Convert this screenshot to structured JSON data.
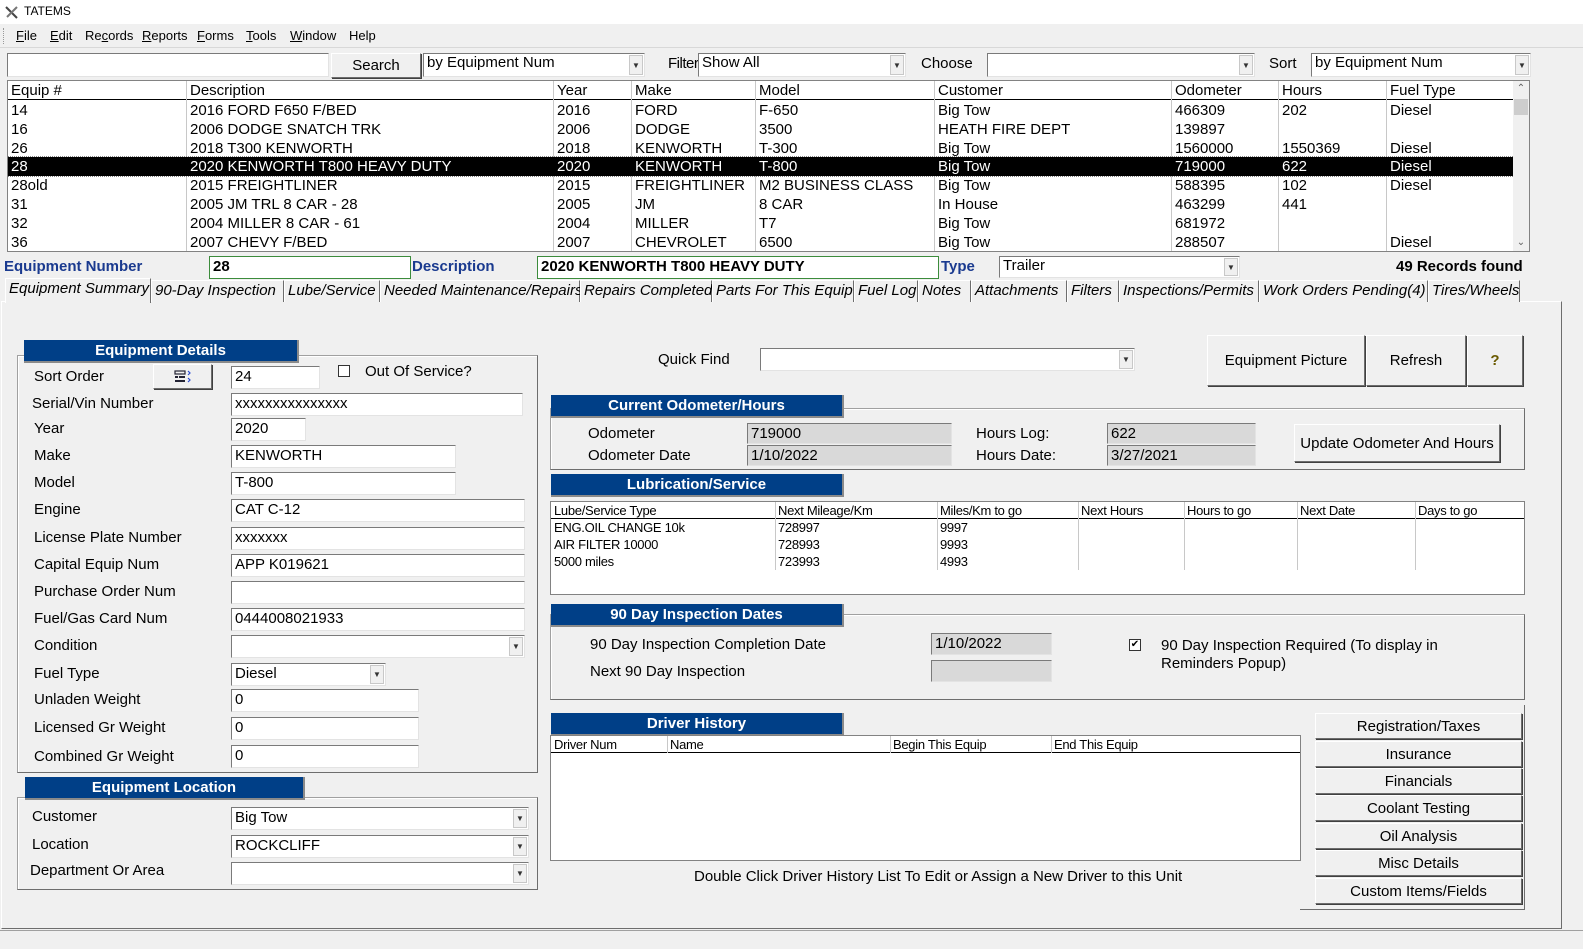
{
  "window": {
    "title": "TATEMS"
  },
  "menu": [
    {
      "label": "File",
      "u": "F",
      "rest": "ile"
    },
    {
      "label": "Edit",
      "u": "E",
      "rest": "dit"
    },
    {
      "label": "Records",
      "pre": "Re",
      "u": "c",
      "rest": "ords"
    },
    {
      "label": "Reports",
      "u": "R",
      "rest": "eports"
    },
    {
      "label": "Forms",
      "u": "F",
      "rest": "orms"
    },
    {
      "label": "Tools",
      "u": "T",
      "rest": "ools"
    },
    {
      "label": "Window",
      "u": "W",
      "rest": "indow"
    },
    {
      "label": "Help",
      "u": "",
      "rest": "Help"
    }
  ],
  "toolbar": {
    "search_value": "",
    "search_button": "Search",
    "search_by": "by Equipment Num",
    "filter_label": "Filter",
    "filter_value": "Show All",
    "choose_label": "Choose",
    "choose_value": "",
    "sort_label": "Sort",
    "sort_value": "by Equipment Num"
  },
  "equipment_list": {
    "columns": [
      "Equip #",
      "Description",
      "Year",
      "Make",
      "Model",
      "Customer",
      "Odometer",
      "Hours",
      "Fuel Type"
    ],
    "rows": [
      [
        "14",
        "2016 FORD F650 F/BED",
        "2016",
        "FORD",
        "F-650",
        "Big Tow",
        "466309",
        "202",
        "Diesel"
      ],
      [
        "16",
        "2006 DODGE  SNATCH TRK",
        "2006",
        "DODGE",
        "3500",
        "HEATH FIRE DEPT",
        "139897",
        "",
        ""
      ],
      [
        "26",
        "2018 T300 KENWORTH",
        "2018",
        "KENWORTH",
        "T-300",
        "Big Tow",
        "1560000",
        "1550369",
        "Diesel"
      ],
      [
        "28",
        "2020 KENWORTH T800 HEAVY DUTY",
        "2020",
        "KENWORTH",
        "T-800",
        "Big Tow",
        "719000",
        "622",
        "Diesel"
      ],
      [
        "28old",
        "2015 FREIGHTLINER",
        "2015",
        "FREIGHTLINER",
        "M2 BUSINESS CLASS",
        "Big Tow",
        "588395",
        "102",
        "Diesel"
      ],
      [
        "31",
        "2005 JM TRL 8 CAR - 28",
        "2005",
        "JM",
        "8 CAR",
        "In House",
        "463299",
        "441",
        ""
      ],
      [
        "32",
        "2004 MILLER 8 CAR - 61",
        "2004",
        "MILLER",
        "T7",
        "Big Tow",
        "681972",
        "",
        ""
      ],
      [
        "36",
        "2007 CHEVY F/BED",
        "2007",
        "CHEVROLET",
        "6500",
        "Big Tow",
        "288507",
        "",
        "Diesel"
      ]
    ],
    "selected_index": 3
  },
  "info_bar": {
    "equipment_number_label": "Equipment Number",
    "equipment_number": "28",
    "description_label": "Description",
    "description": "2020 KENWORTH T800 HEAVY DUTY",
    "type_label": "Type",
    "type_value": "Trailer",
    "records_found": "49 Records found"
  },
  "tabs": [
    "Equipment Summary",
    "90-Day Inspection",
    "Lube/Service",
    "Needed Maintenance/Repairs",
    "Repairs Completed",
    "Parts For This Equip",
    "Fuel Log",
    "Notes",
    "Attachments",
    "Filters",
    "Inspections/Permits",
    "Work Orders Pending(4)",
    "Tires/Wheels"
  ],
  "active_tab": "Equipment Summary",
  "equipment_details": {
    "title": "Equipment Details",
    "sort_order_label": "Sort Order",
    "sort_order": "24",
    "out_of_service_label": "Out Of Service?",
    "out_of_service": false,
    "serial_label": "Serial/Vin Number",
    "serial": "xxxxxxxxxxxxxxx",
    "year_label": "Year",
    "year": "2020",
    "make_label": "Make",
    "make": "KENWORTH",
    "model_label": "Model",
    "model": "T-800",
    "engine_label": "Engine",
    "engine": "CAT C-12",
    "license_label": "License Plate Number",
    "license": "xxxxxxx",
    "capital_label": "Capital Equip Num",
    "capital": "APP K019621",
    "po_label": "Purchase Order Num",
    "po": "",
    "fuelcard_label": "Fuel/Gas Card Num",
    "fuelcard": "0444008021933",
    "condition_label": "Condition",
    "condition": "",
    "fueltype_label": "Fuel Type",
    "fueltype": "Diesel",
    "unladen_label": "Unladen Weight",
    "unladen": "0",
    "licensed_gr_label": "Licensed Gr Weight",
    "licensed_gr": "0",
    "combined_gr_label": "Combined Gr Weight",
    "combined_gr": "0"
  },
  "equipment_location": {
    "title": "Equipment Location",
    "customer_label": "Customer",
    "customer": "Big Tow",
    "location_label": "Location",
    "location": "ROCKCLIFF",
    "department_label": "Department Or Area",
    "department": ""
  },
  "quick_find": {
    "label": "Quick Find",
    "value": ""
  },
  "buttons": {
    "equipment_picture": "Equipment Picture",
    "refresh": "Refresh",
    "help": "?",
    "update_odometer": "Update Odometer And  Hours"
  },
  "odometer": {
    "title": "Current Odometer/Hours",
    "odometer_label": "Odometer",
    "odometer": "719000",
    "odometer_date_label": "Odometer Date",
    "odometer_date": "1/10/2022",
    "hours_log_label": "Hours Log:",
    "hours_log": "622",
    "hours_date_label": "Hours Date:",
    "hours_date": "3/27/2021"
  },
  "lubrication": {
    "title": "Lubrication/Service",
    "columns": [
      "Lube/Service Type",
      "Next Mileage/Km",
      "Miles/Km to go",
      "Next Hours",
      "Hours to go",
      "Next Date",
      "Days to go"
    ],
    "rows": [
      [
        "ENG.OIL CHANGE 10k",
        "728997",
        "9997",
        "",
        "",
        "",
        ""
      ],
      [
        "AIR FILTER 10000",
        "728993",
        "9993",
        "",
        "",
        "",
        ""
      ],
      [
        "5000 miles",
        "723993",
        "4993",
        "",
        "",
        "",
        ""
      ]
    ]
  },
  "inspection": {
    "title": "90 Day Inspection Dates",
    "completion_label": "90 Day Inspection Completion Date",
    "completion_date": "1/10/2022",
    "next_label": "Next 90 Day Inspection",
    "next_date": "",
    "required_label": "90 Day Inspection Required (To display in Reminders Popup)",
    "required": true
  },
  "driver_history": {
    "title": "Driver History",
    "columns": [
      "Driver Num",
      "Name",
      "Begin This Equip",
      "End This Equip"
    ],
    "rows": [],
    "hint": "Double Click Driver History List To Edit or Assign a New Driver to this Unit"
  },
  "side_buttons": [
    "Registration/Taxes",
    "Insurance",
    "Financials",
    "Coolant Testing",
    "Oil Analysis",
    "Misc Details",
    "Custom Items/Fields"
  ],
  "colors": {
    "banner": "#003f87",
    "info_label": "#1a3a8f",
    "selected_row": "#000000"
  }
}
